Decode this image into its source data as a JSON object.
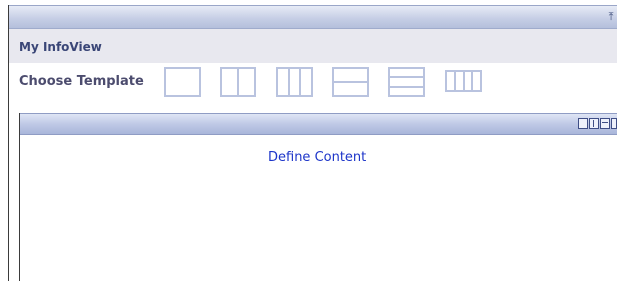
{
  "window": {
    "pin_icon": "pin-icon"
  },
  "header": {
    "title": "My InfoView"
  },
  "templates": {
    "label": "Choose Template",
    "options": [
      "single",
      "two-column",
      "three-column",
      "two-row",
      "three-row",
      "four-column"
    ]
  },
  "panel": {
    "tools": [
      "maximize-icon",
      "two-column-icon",
      "two-row-icon",
      "more-icon"
    ],
    "content_link": "Define Content"
  },
  "colors": {
    "title_text": "#3a4677",
    "link": "#1d35c9",
    "bar": "#c7cfe6"
  }
}
